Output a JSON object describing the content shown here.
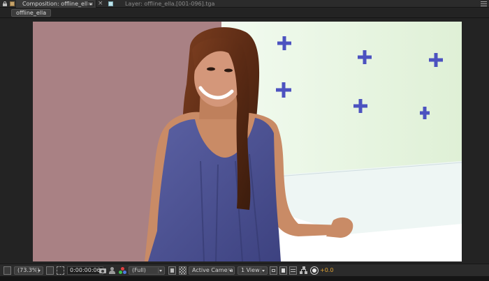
{
  "tabs": {
    "composition_tab_label": "Composition: offline_ella",
    "close_glyph": "×",
    "layer_tab_label": "Layer: offline_ella.[001-096].tga"
  },
  "breadcrumb": {
    "label": "offline_ella"
  },
  "viewer": {
    "background_color": "#a98184",
    "screen_color": "#e6f4de",
    "marker_color": "#4c52c0",
    "tracking_marker_count": 6
  },
  "toolbar": {
    "magnification": "(73.3%)",
    "current_time": "0:00:00:06",
    "resolution": "(Full)",
    "camera": "Active Camera",
    "view_layout": "1 View",
    "exposure": "+0.0",
    "exposure_color": "#e0a232"
  },
  "icons": [
    "lock-icon",
    "composition-icon",
    "close-icon",
    "layer-icon",
    "panel-menu-icon",
    "region-of-interest-icon",
    "safe-margins-icon",
    "mask-visibility-icon",
    "snapshot-icon",
    "show-snapshot-icon",
    "color-channel-icon",
    "fast-previews-icon",
    "transparency-grid-icon",
    "toggle-pixel-aspect-icon",
    "render-toggle-icon",
    "flowchart-icon",
    "exposure-icon"
  ]
}
